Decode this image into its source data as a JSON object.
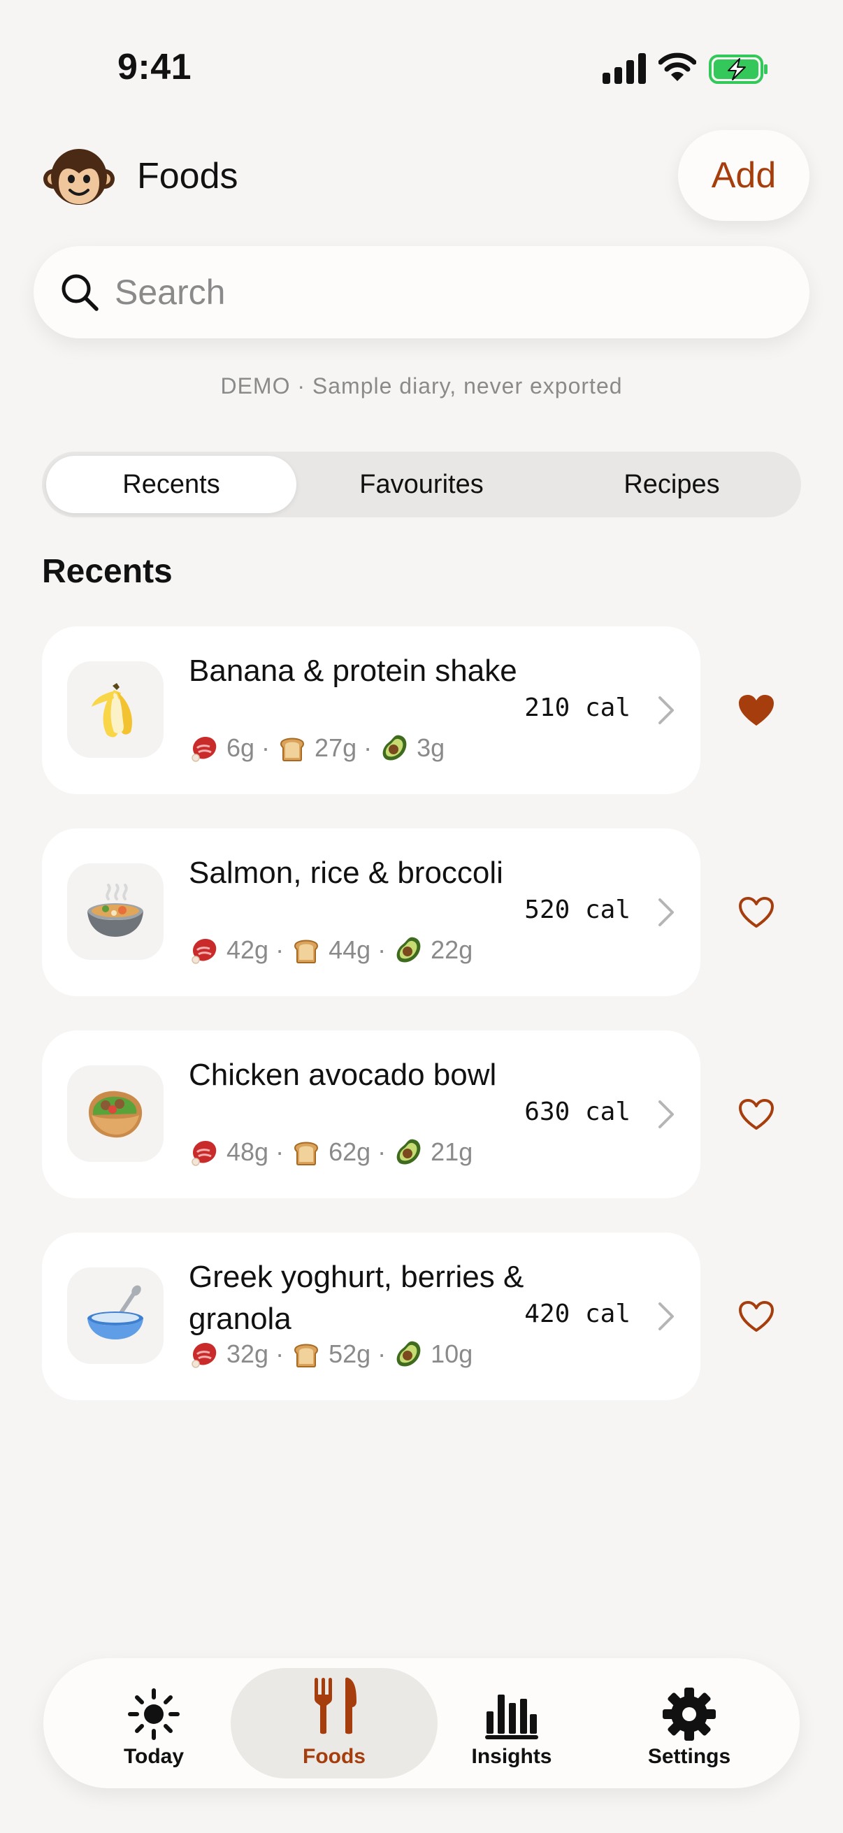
{
  "status": {
    "time": "9:41"
  },
  "header": {
    "title": "Foods",
    "add_label": "Add"
  },
  "search": {
    "placeholder": "Search",
    "value": ""
  },
  "demo_note": "DEMO · Sample diary, never exported",
  "tabs": [
    {
      "label": "Recents",
      "active": true
    },
    {
      "label": "Favourites",
      "active": false
    },
    {
      "label": "Recipes",
      "active": false
    }
  ],
  "section_title": "Recents",
  "foods": [
    {
      "name": "Banana & protein shake",
      "calories": "210 cal",
      "protein": "6g",
      "carbs": "27g",
      "fat": "3g",
      "favourite": true,
      "icon": "banana-icon"
    },
    {
      "name": "Salmon, rice & broccoli",
      "calories": "520 cal",
      "protein": "42g",
      "carbs": "44g",
      "fat": "22g",
      "favourite": false,
      "icon": "pot-of-food-icon"
    },
    {
      "name": "Chicken avocado bowl",
      "calories": "630 cal",
      "protein": "48g",
      "carbs": "62g",
      "fat": "21g",
      "favourite": false,
      "icon": "stuffed-flatbread-icon"
    },
    {
      "name": "Greek yoghurt, berries & granola",
      "calories": "420 cal",
      "protein": "32g",
      "carbs": "52g",
      "fat": "10g",
      "favourite": false,
      "icon": "bowl-with-spoon-icon"
    }
  ],
  "macro_icons": {
    "protein": "meat-icon",
    "carbs": "bread-icon",
    "fat": "avocado-icon"
  },
  "nav": [
    {
      "label": "Today",
      "icon": "sun-icon",
      "active": false
    },
    {
      "label": "Foods",
      "icon": "fork-knife-icon",
      "active": true
    },
    {
      "label": "Insights",
      "icon": "bar-chart-icon",
      "active": false
    },
    {
      "label": "Settings",
      "icon": "gear-icon",
      "active": false
    }
  ],
  "colors": {
    "accent": "#a63d0c",
    "background": "#f7f5f3",
    "card": "#ffffff",
    "muted": "#8a8a8a"
  }
}
